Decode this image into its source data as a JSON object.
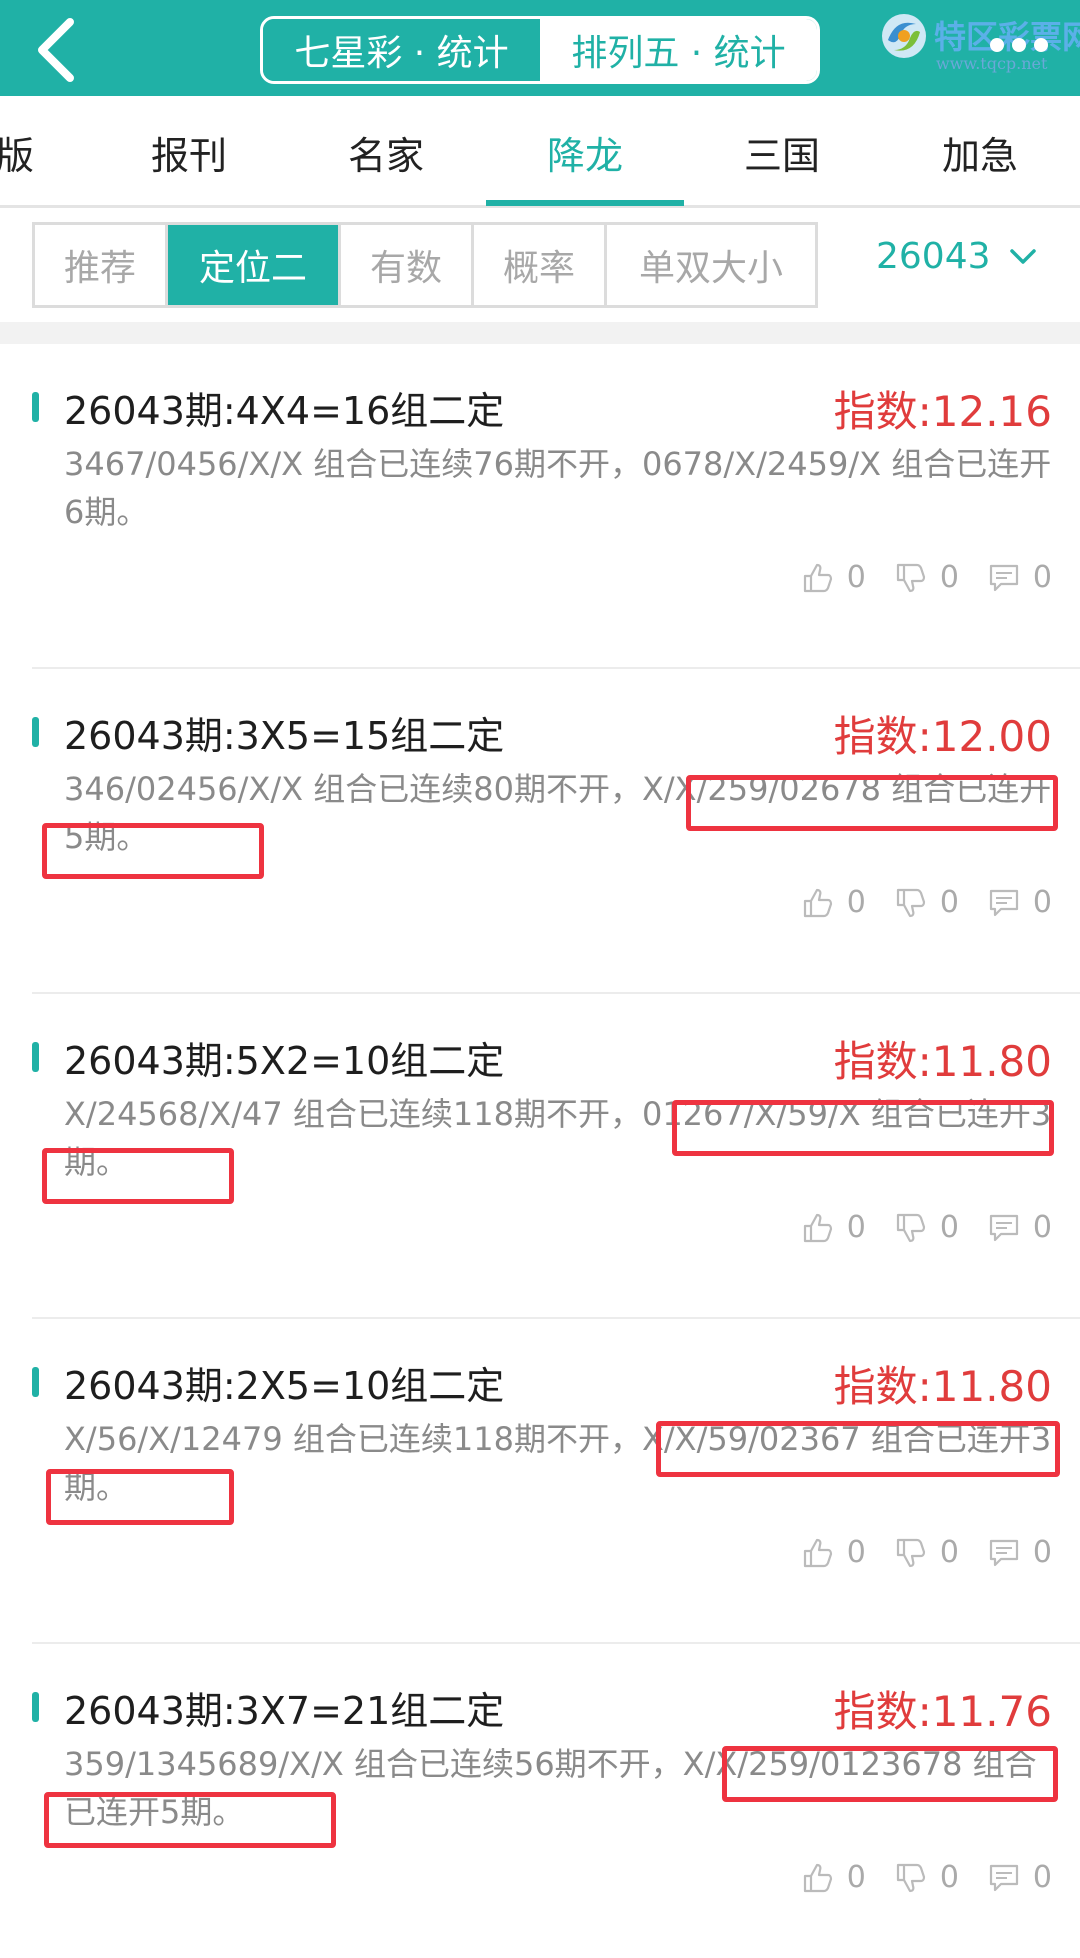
{
  "header": {
    "back_icon": "chevron-left-icon",
    "segments": [
      {
        "label": "七星彩 · 统计",
        "active": true
      },
      {
        "label": "排列五 · 统计",
        "active": false
      }
    ],
    "logo_text": "特区彩票网",
    "logo_url": "www.tqcp.net",
    "more_icon": "more-dots-icon"
  },
  "categories": [
    {
      "label": "版"
    },
    {
      "label": "报刊"
    },
    {
      "label": "名家"
    },
    {
      "label": "降龙",
      "active": true
    },
    {
      "label": "三国"
    },
    {
      "label": "加急"
    }
  ],
  "subtabs": [
    {
      "label": "推荐"
    },
    {
      "label": "定位二",
      "active": true
    },
    {
      "label": "有数"
    },
    {
      "label": "概率"
    },
    {
      "label": "单双大小"
    }
  ],
  "issue_selector": {
    "value": "26043",
    "icon": "chevron-down-icon"
  },
  "records": [
    {
      "title": "26043期:4X4=16组二定",
      "index": "指数:12.16",
      "desc": "3467/0456/X/X 组合已连续76期不开，0678/X/2459/X 组合已连开6期。",
      "likes": "0",
      "dislikes": "0",
      "comments": "0"
    },
    {
      "title": "26043期:3X5=15组二定",
      "index": "指数:12.00",
      "desc": "346/02456/X/X 组合已连续80期不开，X/X/259/02678 组合已连开5期。",
      "likes": "0",
      "dislikes": "0",
      "comments": "0"
    },
    {
      "title": "26043期:5X2=10组二定",
      "index": "指数:11.80",
      "desc": "X/24568/X/47 组合已连续118期不开，01267/X/59/X 组合已连开3期。",
      "likes": "0",
      "dislikes": "0",
      "comments": "0"
    },
    {
      "title": "26043期:2X5=10组二定",
      "index": "指数:11.80",
      "desc": "X/56/X/12479 组合已连续118期不开，X/X/59/02367 组合已连开3期。",
      "likes": "0",
      "dislikes": "0",
      "comments": "0"
    },
    {
      "title": "26043期:3X7=21组二定",
      "index": "指数:11.76",
      "desc": "359/1345689/X/X 组合已连续56期不开，X/X/259/0123678 组合已连开5期。",
      "likes": "0",
      "dislikes": "0",
      "comments": "0"
    }
  ],
  "colors": {
    "accent": "#20b1a6",
    "index_red": "#e03c3c",
    "highlight_red": "#ee3340",
    "muted_text": "#8a8a8a"
  }
}
